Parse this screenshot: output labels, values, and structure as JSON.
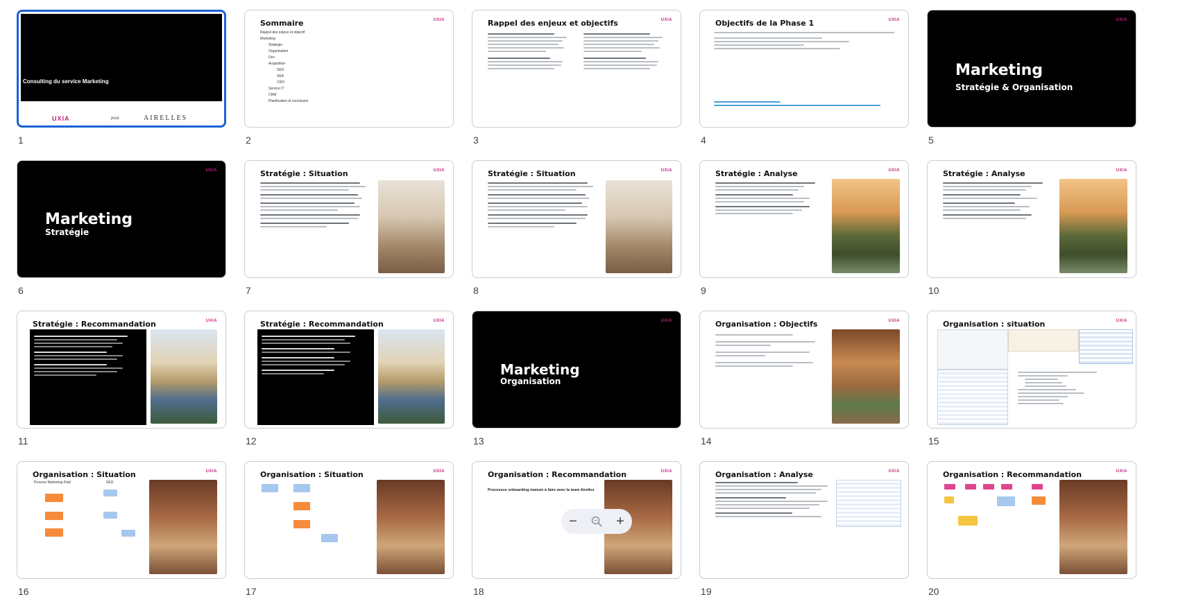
{
  "slides": [
    {
      "n": "1",
      "title": "Consulting du service Marketing",
      "logo": "UXIA",
      "pour": "pour",
      "client": "AIRELLES"
    },
    {
      "n": "2",
      "title": "Sommaire",
      "items": [
        "Rappel des enjeux et objectif",
        "Marketing",
        "Stratégie",
        "Organisation",
        "Dev",
        "Acquisition",
        "SEO",
        "SEA",
        "CRO",
        "Service IT",
        "CRM",
        "Planification et conclusion"
      ]
    },
    {
      "n": "3",
      "title": "Rappel des enjeux et objectifs"
    },
    {
      "n": "4",
      "title": "Objectifs de la Phase 1"
    },
    {
      "n": "5",
      "title": "Marketing",
      "subtitle": "Stratégie & Organisation"
    },
    {
      "n": "6",
      "title": "Marketing",
      "subtitle": "Stratégie"
    },
    {
      "n": "7",
      "title": "Stratégie : Situation"
    },
    {
      "n": "8",
      "title": "Stratégie : Situation"
    },
    {
      "n": "9",
      "title": "Stratégie : Analyse"
    },
    {
      "n": "10",
      "title": "Stratégie : Analyse"
    },
    {
      "n": "11",
      "title": "Stratégie : Recommandation"
    },
    {
      "n": "12",
      "title": "Stratégie : Recommandation"
    },
    {
      "n": "13",
      "title": "Marketing",
      "subtitle": "Organisation"
    },
    {
      "n": "14",
      "title": "Organisation : Objectifs"
    },
    {
      "n": "15",
      "title": "Organisation  : situation"
    },
    {
      "n": "16",
      "title": "Organisation : Situation",
      "labels": [
        "Process Marketing Paid",
        "SEO"
      ]
    },
    {
      "n": "17",
      "title": "Organisation : Situation"
    },
    {
      "n": "18",
      "title": "Organisation : Recommandation",
      "subtitle": "Processus onboarding maison à faire avec la team Airelles"
    },
    {
      "n": "19",
      "title": "Organisation : Analyse"
    },
    {
      "n": "20",
      "title": "Organisation : Recommandation"
    }
  ],
  "logo": "UXIA",
  "zoom": {
    "minus": "−",
    "plus": "+"
  },
  "colors": {
    "selection": "#1b62d6",
    "brand": "#c2257c"
  }
}
